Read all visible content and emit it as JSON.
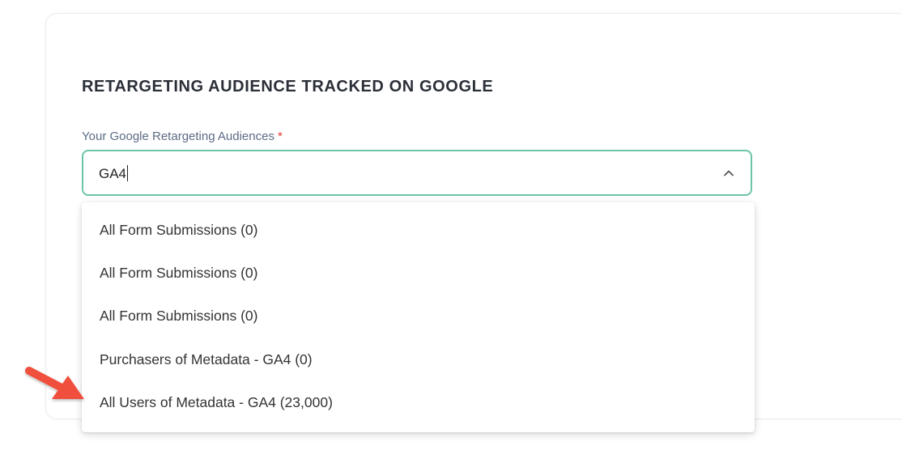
{
  "section": {
    "title": "RETARGETING AUDIENCE TRACKED ON GOOGLE"
  },
  "field": {
    "label": "Your Google Retargeting Audiences",
    "required_mark": "*",
    "value": "GA4"
  },
  "dropdown": {
    "options": [
      "All Form Submissions (0)",
      "All Form Submissions (0)",
      "All Form Submissions (0)",
      "Purchasers of Metadata - GA4 (0)",
      "All Users of Metadata - GA4 (23,000)"
    ]
  },
  "icons": {
    "chevron": "chevron-up-icon",
    "annotation": "red-arrow-icon"
  },
  "colors": {
    "focus_border": "#6cc5a8",
    "required": "#e53935",
    "arrow": "#f0503e"
  }
}
